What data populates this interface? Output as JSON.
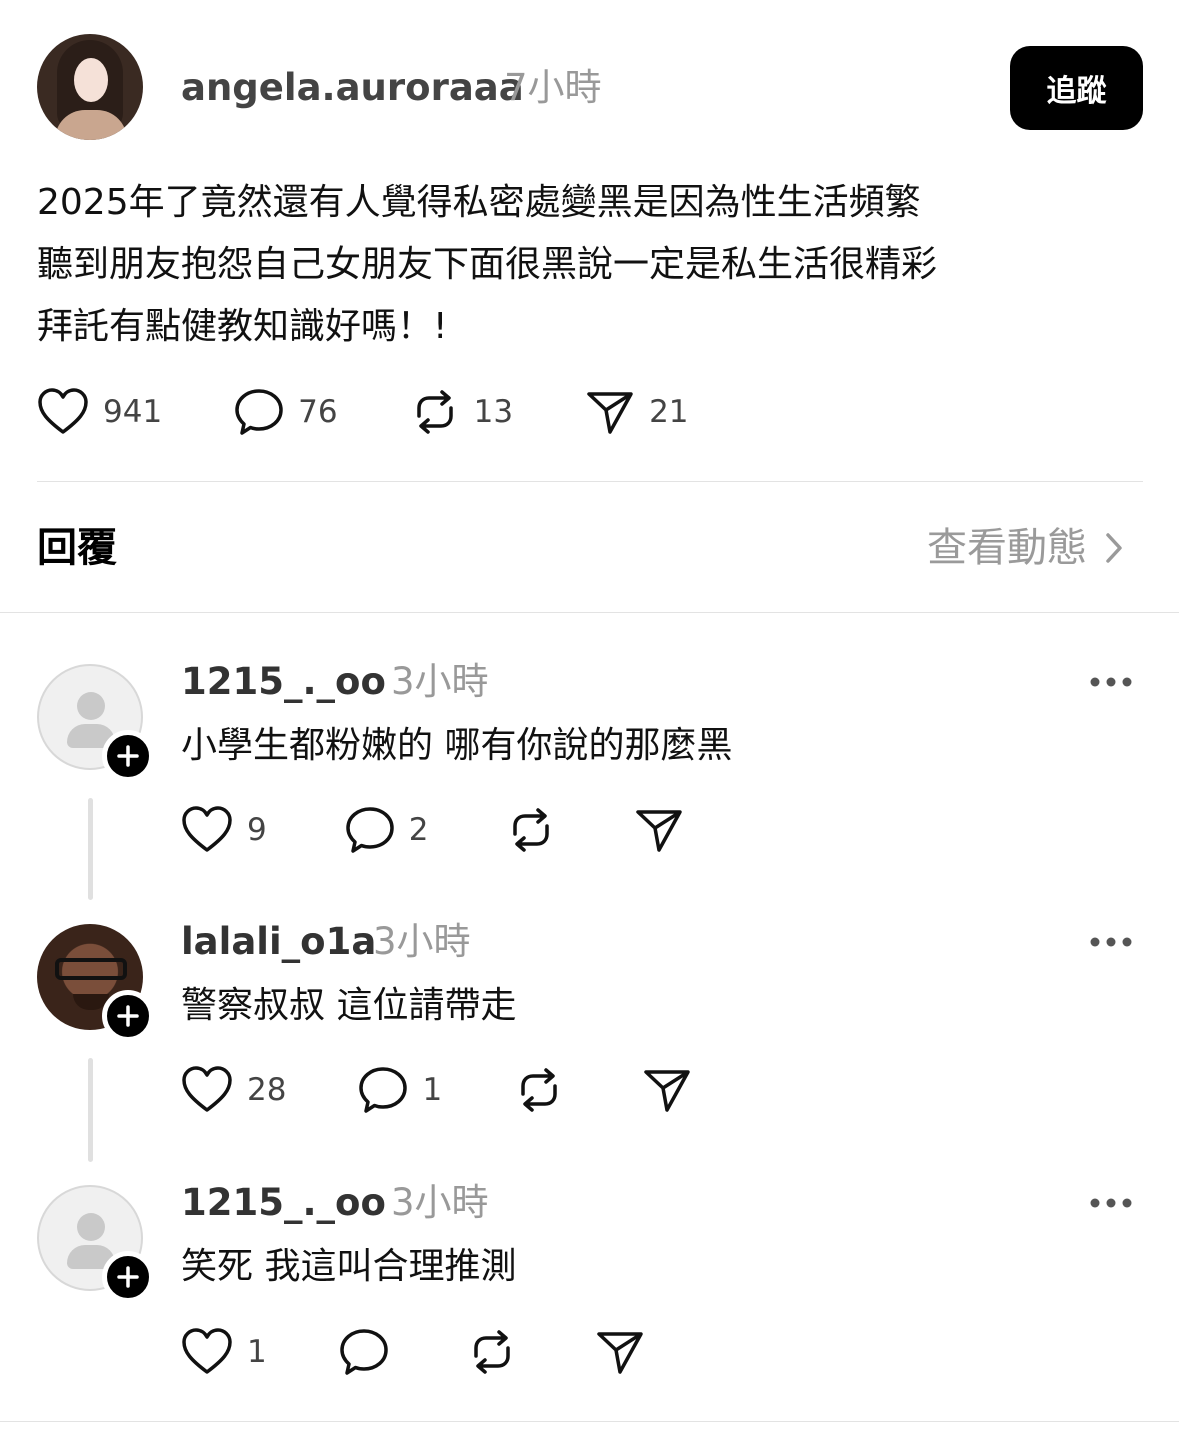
{
  "post": {
    "username": "angela.auroraaa",
    "time": "7小時",
    "follow_label": "追蹤",
    "lines": [
      "2025年了竟然還有人覺得私密處變黑是因為性生活頻繁",
      "聽到朋友抱怨自己女朋友下面很黑說一定是私生活很精彩",
      "拜託有點健教知識好嗎！!"
    ],
    "likes": "941",
    "comments": "76",
    "reposts": "13",
    "shares": "21"
  },
  "section": {
    "replies_title": "回覆",
    "view_activity": "查看動態"
  },
  "replies": [
    {
      "username": "1215_._oo",
      "time": "3小時",
      "text": "小學生都粉嫩的 哪有你說的那麼黑",
      "likes": "9",
      "comments": "2",
      "avatar": "default-avatar-icon"
    },
    {
      "username": "lalali_o1a",
      "time": "3小時",
      "text": "警察叔叔 這位請帶走",
      "likes": "28",
      "comments": "1",
      "avatar": "photo"
    },
    {
      "username": "1215_._oo",
      "time": "3小時",
      "text": "笑死 我這叫合理推測",
      "likes": "1",
      "comments": "",
      "avatar": "default-avatar-icon"
    }
  ],
  "icons": {
    "like": "heart-icon",
    "comment": "comment-bubble-icon",
    "repost": "repost-icon",
    "share": "send-icon",
    "more": "more-dots-icon",
    "follow_badge": "plus-icon",
    "chevron": "chevron-right-icon"
  }
}
